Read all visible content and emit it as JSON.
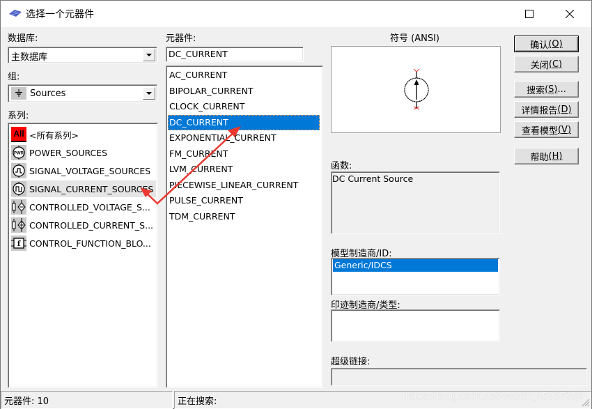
{
  "window": {
    "title": "选择一个元器件",
    "controls": {
      "maximize": "maximize-icon",
      "close": "close-icon"
    }
  },
  "database": {
    "label": "数据库:",
    "selected": "主数据库"
  },
  "group": {
    "label": "组:",
    "selected": "Sources",
    "icon": "ground-source-icon"
  },
  "series": {
    "label": "系列:",
    "items": [
      {
        "label": "<所有系列>",
        "icon": "all-icon",
        "icon_text": "All"
      },
      {
        "label": "POWER_SOURCES",
        "icon": "power-source-icon",
        "icon_text": "PWR"
      },
      {
        "label": "SIGNAL_VOLTAGE_SOURCES",
        "icon": "signal-voltage-icon"
      },
      {
        "label": "SIGNAL_CURRENT_SOURCES",
        "icon": "signal-current-icon"
      },
      {
        "label": "CONTROLLED_VOLTAGE_S...",
        "icon": "controlled-voltage-icon"
      },
      {
        "label": "CONTROLLED_CURRENT_S...",
        "icon": "controlled-current-icon"
      },
      {
        "label": "CONTROL_FUNCTION_BLO...",
        "icon": "function-block-icon",
        "icon_text": "f"
      }
    ],
    "highlighted_index": 3
  },
  "component": {
    "label": "元器件:",
    "search_value": "DC_CURRENT",
    "items": [
      "AC_CURRENT",
      "BIPOLAR_CURRENT",
      "CLOCK_CURRENT",
      "DC_CURRENT",
      "EXPONENTIAL_CURRENT",
      "FM_CURRENT",
      "LVM_CURRENT",
      "PIECEWISE_LINEAR_CURRENT",
      "PULSE_CURRENT",
      "TDM_CURRENT"
    ],
    "selected_index": 3
  },
  "symbol": {
    "label": "符号 (ANSI)",
    "icon": "dc-current-source-symbol"
  },
  "function": {
    "label": "函数:",
    "value": "DC Current Source"
  },
  "model": {
    "label": "模型制造商/ID:",
    "items": [
      "Generic/IDCS"
    ],
    "selected_index": 0
  },
  "footprint": {
    "label": "印迹制造商/类型:",
    "items": []
  },
  "hyperlink": {
    "label": "超级链接:",
    "value": ""
  },
  "buttons": {
    "ok": {
      "text": "确认",
      "mnemonic": "(O)"
    },
    "close": {
      "text": "关闭",
      "mnemonic": "(C)"
    },
    "search": {
      "text": "搜索",
      "mnemonic": "(S)",
      "suffix": "..."
    },
    "detail_report": {
      "text": "详情报告",
      "mnemonic": "(D)"
    },
    "view_model": {
      "text": "查看模型",
      "mnemonic": "(V)"
    },
    "help": {
      "text": "帮助",
      "mnemonic": "(H)"
    }
  },
  "status": {
    "component_count": "元器件: 10",
    "searching": "正在搜索:"
  },
  "annotations": {
    "arrow_color": "#e8382f",
    "selection_color": "#0078d7"
  },
  "watermark": "https://blog.csdn.net/weixin_45967696"
}
